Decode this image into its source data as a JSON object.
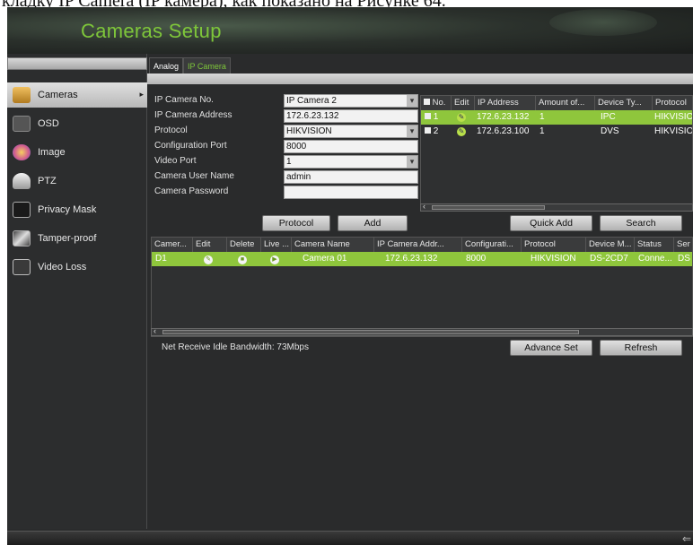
{
  "doc_caption": "кладку IP Camera (IP камера), как показано на Рисунке 64.",
  "window": {
    "title": "Cameras Setup"
  },
  "sidebar": {
    "items": [
      {
        "label": "Cameras",
        "icon": "camera-icon",
        "active": true
      },
      {
        "label": "OSD",
        "icon": "osd-icon"
      },
      {
        "label": "Image",
        "icon": "image-icon"
      },
      {
        "label": "PTZ",
        "icon": "ptz-icon"
      },
      {
        "label": "Privacy Mask",
        "icon": "privacy-mask-icon"
      },
      {
        "label": "Tamper-proof",
        "icon": "tamper-proof-icon"
      },
      {
        "label": "Video Loss",
        "icon": "video-loss-icon"
      }
    ]
  },
  "tabs": [
    {
      "label": "Analog"
    },
    {
      "label": "IP Camera",
      "active": true
    }
  ],
  "form": {
    "fields": [
      {
        "label": "IP Camera No.",
        "value": "IP Camera 2",
        "type": "select"
      },
      {
        "label": "IP Camera Address",
        "value": "172.6.23.132",
        "type": "text"
      },
      {
        "label": "Protocol",
        "value": "HIKVISION",
        "type": "select"
      },
      {
        "label": "Configuration Port",
        "value": "8000",
        "type": "text"
      },
      {
        "label": "Video Port",
        "value": "1",
        "type": "select"
      },
      {
        "label": "Camera User Name",
        "value": "admin",
        "type": "text"
      },
      {
        "label": "Camera Password",
        "value": "",
        "type": "password"
      }
    ]
  },
  "device_table": {
    "headers": [
      "No.",
      "Edit",
      "IP Address",
      "Amount of...",
      "Device Ty...",
      "Protocol"
    ],
    "rows": [
      {
        "no": "1",
        "ip": "172.6.23.132",
        "amount": "1",
        "type": "IPC",
        "protocol": "HIKVISIO"
      },
      {
        "no": "2",
        "ip": "172.6.23.100",
        "amount": "1",
        "type": "DVS",
        "protocol": "HIKVISIO"
      }
    ]
  },
  "buttons": {
    "protocol": "Protocol",
    "add": "Add",
    "quick_add": "Quick Add",
    "search": "Search",
    "advance_set": "Advance Set",
    "refresh": "Refresh"
  },
  "camera_table": {
    "headers": [
      "Camer...",
      "Edit",
      "Delete",
      "Live ...",
      "Camera Name",
      "IP Camera Addr...",
      "Configurati...",
      "Protocol",
      "Device M...",
      "Status",
      "Ser"
    ],
    "rows": [
      {
        "camera": "D1",
        "name": "Camera 01",
        "ip": "172.6.23.132",
        "config": "8000",
        "protocol": "HIKVISION",
        "model": "DS-2CD7",
        "status": "Conne...",
        "serial": "DS"
      }
    ]
  },
  "bandwidth": "Net Receive Idle Bandwidth: 73Mbps",
  "colors": {
    "accent": "#7ec63a",
    "selection": "#8fc63c"
  }
}
